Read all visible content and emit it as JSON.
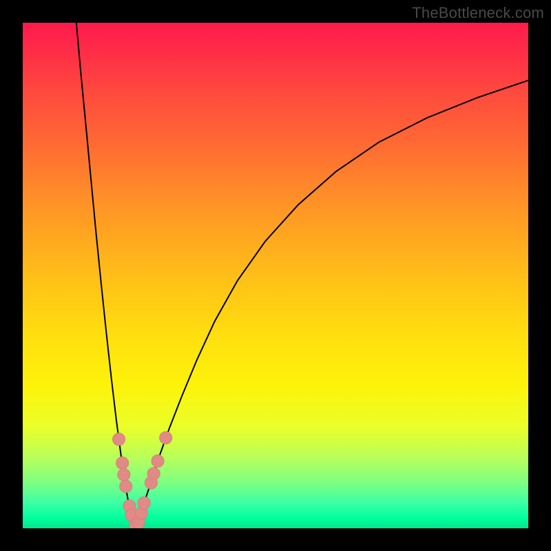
{
  "watermark": "TheBottleneck.com",
  "colors": {
    "frame": "#000000",
    "curve": "#000000",
    "marker_fill": "#e18a86",
    "marker_stroke": "#da7c78"
  },
  "chart_data": {
    "type": "line",
    "title": "",
    "xlabel": "",
    "ylabel": "",
    "xlim": [
      0,
      100
    ],
    "ylim": [
      0,
      100
    ],
    "note": "Axes are unitless percentages inferred from pixel positions; x maps left→right 0–100, y maps bottom→top 0–100.",
    "series": [
      {
        "name": "left-branch",
        "x": [
          10.6,
          11.5,
          12.5,
          13.5,
          14.5,
          15.5,
          16.5,
          17.5,
          18.5,
          19.5,
          20.3,
          21.0,
          21.7,
          22.3
        ],
        "y": [
          100.0,
          90.0,
          79.5,
          69.0,
          58.5,
          48.5,
          39.0,
          30.0,
          21.5,
          14.0,
          8.5,
          4.7,
          2.3,
          0.5
        ]
      },
      {
        "name": "right-branch",
        "x": [
          22.6,
          23.3,
          24.2,
          25.5,
          27.0,
          29.0,
          31.5,
          34.5,
          38.0,
          42.5,
          48.0,
          54.5,
          62.0,
          70.5,
          80.0,
          90.0,
          100.0
        ],
        "y": [
          0.5,
          2.6,
          5.6,
          9.5,
          14.2,
          19.8,
          26.2,
          33.4,
          41.0,
          49.0,
          56.8,
          64.0,
          70.6,
          76.4,
          81.2,
          85.2,
          88.6
        ]
      }
    ],
    "markers": [
      {
        "series": "left-branch",
        "x": 19.0,
        "y": 17.6
      },
      {
        "series": "left-branch",
        "x": 19.7,
        "y": 12.9
      },
      {
        "series": "left-branch",
        "x": 20.0,
        "y": 10.6
      },
      {
        "series": "left-branch",
        "x": 20.4,
        "y": 8.3
      },
      {
        "series": "left-branch",
        "x": 21.1,
        "y": 4.4
      },
      {
        "series": "left-branch",
        "x": 21.5,
        "y": 2.6
      },
      {
        "series": "left-branch",
        "x": 22.3,
        "y": 0.7
      },
      {
        "series": "right-branch",
        "x": 22.9,
        "y": 1.1
      },
      {
        "series": "right-branch",
        "x": 23.5,
        "y": 3.0
      },
      {
        "series": "right-branch",
        "x": 24.0,
        "y": 5.0
      },
      {
        "series": "right-branch",
        "x": 25.4,
        "y": 9.0
      },
      {
        "series": "right-branch",
        "x": 25.9,
        "y": 10.8
      },
      {
        "series": "right-branch",
        "x": 26.7,
        "y": 13.3
      },
      {
        "series": "right-branch",
        "x": 28.3,
        "y": 17.9
      }
    ]
  }
}
